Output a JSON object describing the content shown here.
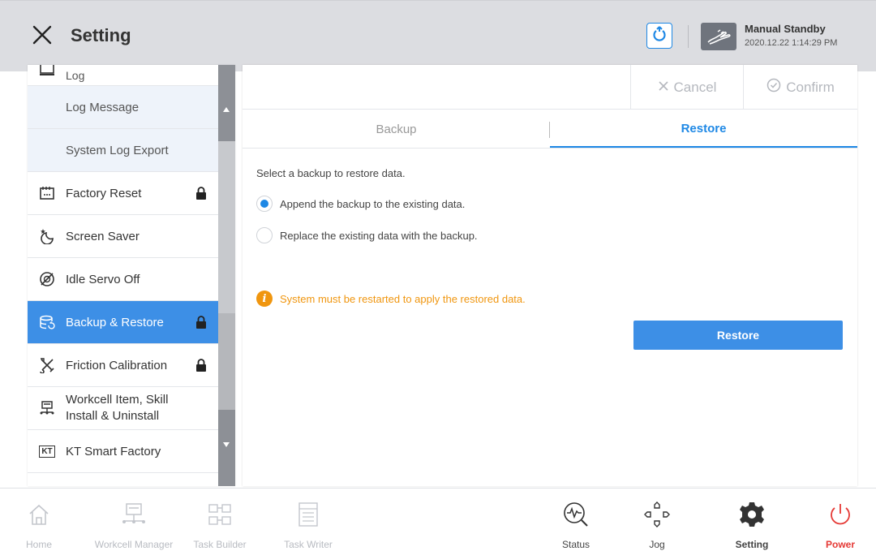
{
  "header": {
    "title": "Setting",
    "mode_status": "Manual Standby",
    "mode_time": "2020.12.22 1:14:29 PM"
  },
  "sidebar": {
    "items": [
      {
        "label": "Log",
        "icon": "log-icon",
        "locked": false
      },
      {
        "label": "Log Message",
        "sub": true
      },
      {
        "label": "System Log Export",
        "sub": true
      },
      {
        "label": "Factory Reset",
        "icon": "factory-reset-icon",
        "locked": true
      },
      {
        "label": "Screen Saver",
        "icon": "screen-saver-icon",
        "locked": false
      },
      {
        "label": "Idle Servo Off",
        "icon": "idle-servo-off-icon",
        "locked": false
      },
      {
        "label": "Backup & Restore",
        "icon": "backup-restore-icon",
        "locked": true,
        "active": true
      },
      {
        "label": "Friction Calibration",
        "icon": "friction-calibration-icon",
        "locked": true
      },
      {
        "label_line1": "Workcell Item, Skill",
        "label_line2": "Install & Uninstall",
        "icon": "workcell-install-icon",
        "locked": false
      },
      {
        "label": "KT Smart Factory",
        "icon": "kt-icon",
        "icon_text": "KT",
        "locked": false
      }
    ]
  },
  "panel": {
    "cancel_label": "Cancel",
    "confirm_label": "Confirm",
    "tabs": [
      {
        "label": "Backup",
        "active": false
      },
      {
        "label": "Restore",
        "active": true
      }
    ],
    "prompt": "Select a backup to restore data.",
    "options": [
      {
        "label": "Append the backup to the existing data.",
        "selected": true
      },
      {
        "label": "Replace the existing data with the backup.",
        "selected": false
      }
    ],
    "warning": "System must be restarted to apply the restored data.",
    "restore_button": "Restore"
  },
  "bottom_nav": [
    {
      "label": "Home",
      "icon": "home-icon",
      "state": "disabled"
    },
    {
      "label": "Workcell Manager",
      "icon": "workcell-manager-icon",
      "state": "disabled"
    },
    {
      "label": "Task Builder",
      "icon": "task-builder-icon",
      "state": "disabled"
    },
    {
      "label": "Task Writer",
      "icon": "task-writer-icon",
      "state": "disabled"
    },
    {
      "label": "Status",
      "icon": "status-icon",
      "state": "enabled"
    },
    {
      "label": "Jog",
      "icon": "jog-icon",
      "state": "enabled"
    },
    {
      "label": "Setting",
      "icon": "gear-icon",
      "state": "active"
    },
    {
      "label": "Power",
      "icon": "power-icon",
      "state": "power"
    }
  ],
  "colors": {
    "accent": "#1e88e5",
    "active_item": "#3d8fe6",
    "warning": "#f0960f",
    "power": "#e53935"
  }
}
